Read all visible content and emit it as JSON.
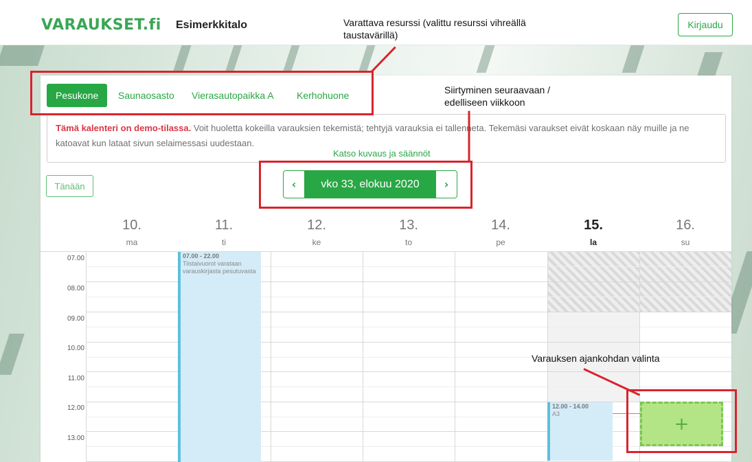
{
  "header": {
    "logo": "VARAUKSET.fi",
    "site_name": "Esimerkkitalo",
    "login_label": "Kirjaudu"
  },
  "tabs": [
    {
      "label": "Pesukone",
      "active": true
    },
    {
      "label": "Saunaosasto",
      "active": false
    },
    {
      "label": "Vierasautopaikka A",
      "active": false
    },
    {
      "label": "Kerhohuone",
      "active": false
    }
  ],
  "notice": {
    "bold_text": "Tämä kalenteri on demo-tilassa.",
    "body_text": "Voit huoletta kokeilla varauksien tekemistä; tehtyjä varauksia ei tallenneta. Tekemäsi varaukset eivät koskaan näy muille ja ne katoavat kun lataat sivun selaimessasi uudestaan.",
    "link_text": "Katso kuvaus ja säännöt"
  },
  "today_label": "Tänään",
  "week_nav": {
    "prev_glyph": "‹",
    "label": "vko 33, elokuu 2020",
    "next_glyph": "›"
  },
  "days": [
    {
      "num": "10.",
      "name": "ma"
    },
    {
      "num": "11.",
      "name": "ti"
    },
    {
      "num": "12.",
      "name": "ke"
    },
    {
      "num": "13.",
      "name": "to"
    },
    {
      "num": "14.",
      "name": "pe"
    },
    {
      "num": "15.",
      "name": "la",
      "today": true
    },
    {
      "num": "16.",
      "name": "su"
    }
  ],
  "times": [
    "07.00",
    "08.00",
    "09.00",
    "10.00",
    "11.00",
    "12.00",
    "13.00"
  ],
  "events": {
    "tuesday": {
      "time": "07.00 - 22.00",
      "desc": "Tiistaivuorot varataan varauskirjasta pesutuvasta"
    },
    "saturday": {
      "time": "12.00 - 14.00",
      "desc": "A3"
    }
  },
  "add_icon": "+",
  "annotations": {
    "resource": "Varattava resurssi (valittu resurssi vihreällä taustavärillä)",
    "week": "Siirtyminen seuraavaan / edelliseen viikkoon",
    "slot": "Varauksen ajankohdan valinta"
  },
  "colors": {
    "brand_green": "#28a745",
    "logo_green": "#3aa655",
    "demo_red": "#dc3545",
    "event_blue": "#d4ecf7",
    "annotation_red": "#d9232d"
  }
}
